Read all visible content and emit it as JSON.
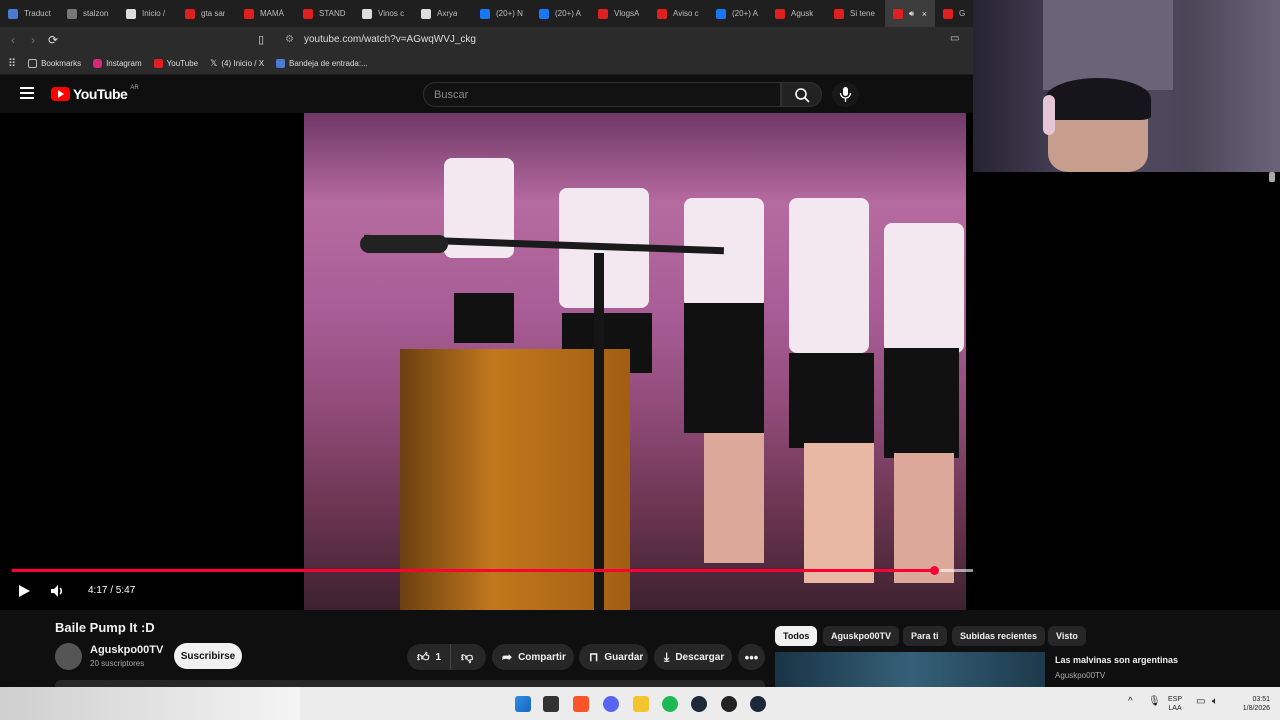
{
  "browser": {
    "tabs": [
      {
        "label": "Traduct",
        "color": "#4a7bd0"
      },
      {
        "label": "stalzon",
        "color": "#777777"
      },
      {
        "label": "Inicio /",
        "color": "#dddddd"
      },
      {
        "label": "gta sar",
        "color": "#e02020"
      },
      {
        "label": "MAMÁ",
        "color": "#e02020"
      },
      {
        "label": "STAND",
        "color": "#e02020"
      },
      {
        "label": "Vinos c",
        "color": "#dddddd"
      },
      {
        "label": "Axrya",
        "color": "#dddddd"
      },
      {
        "label": "(20+) N",
        "color": "#1877f2"
      },
      {
        "label": "(20+) A",
        "color": "#1877f2"
      },
      {
        "label": "VlogsA",
        "color": "#e02020"
      },
      {
        "label": "Aviso c",
        "color": "#e02020"
      },
      {
        "label": "(20+) A",
        "color": "#1877f2"
      },
      {
        "label": "Agusk",
        "color": "#e02020"
      },
      {
        "label": "Si tene",
        "color": "#e02020"
      }
    ],
    "active_tab": {
      "close": "×",
      "color": "#e02020"
    },
    "last_tab": {
      "label": "G",
      "color": "#e02020"
    },
    "url": "youtube.com/watch?v=AGwqWVJ_ckg",
    "bookmarks": [
      {
        "label": "Bookmarks",
        "color": "#bbbbbb"
      },
      {
        "label": "Instagram",
        "color": "#d62976"
      },
      {
        "label": "YouTube",
        "color": "#e02020"
      },
      {
        "label": "(4) Inicio / X",
        "color": "#dddddd"
      },
      {
        "label": "Bandeja de entrada:...",
        "color": "#4a7bd0"
      }
    ]
  },
  "youtube": {
    "logo_text": "YouTube",
    "region": "AR",
    "search_placeholder": "Buscar"
  },
  "player": {
    "time": "4:17 / 5:47",
    "progress": 0.74,
    "buffered": 0.815
  },
  "video": {
    "title": "Baile Pump It :D",
    "channel": "Aguskpo00TV",
    "subscribers": "20 suscriptores",
    "subscribe_label": "Suscribirse",
    "likes": "1",
    "share_label": "Compartir",
    "save_label": "Guardar",
    "download_label": "Descargar"
  },
  "chips": [
    "Todos",
    "Aguskpo00TV",
    "Para ti",
    "Subidas recientes",
    "Visto"
  ],
  "recommendation": {
    "title": "Las malvinas son argentinas",
    "channel": "Aguskpo00TV"
  },
  "taskbar": {
    "lang_top": "ESP",
    "lang_bottom": "LAA",
    "time": "03:51",
    "date": "1/8/2026"
  }
}
